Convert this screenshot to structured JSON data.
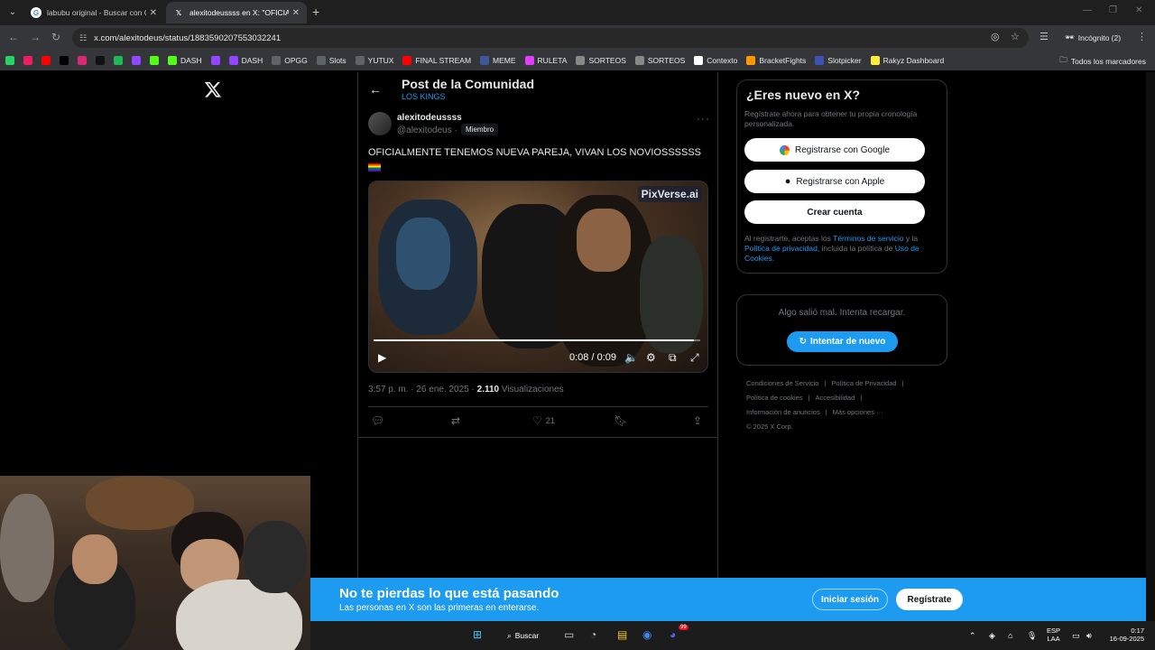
{
  "browser": {
    "tabs": [
      {
        "title": "labubu original - Buscar con Google",
        "icon": "google-icon",
        "active": false
      },
      {
        "title": "alexitodeussss en X: \"OFICIALMENTE",
        "icon": "x-icon",
        "active": true
      }
    ],
    "url": "x.com/alexitodeus/status/1883590207553032241",
    "incognito_label": "Incógnito (2)",
    "bookmarks": [
      {
        "label": "",
        "icon": "whatsapp-icon",
        "color": "#25d366"
      },
      {
        "label": "",
        "icon": "app-icon",
        "color": "#e91e63"
      },
      {
        "label": "",
        "icon": "youtube-icon",
        "color": "#ff0000"
      },
      {
        "label": "",
        "icon": "x-icon",
        "color": "#000000"
      },
      {
        "label": "",
        "icon": "instagram-icon",
        "color": "#d62976"
      },
      {
        "label": "",
        "icon": "tiktok-icon",
        "color": "#111111"
      },
      {
        "label": "",
        "icon": "spotify-icon",
        "color": "#1db954"
      },
      {
        "label": "",
        "icon": "twitch-icon",
        "color": "#9146ff"
      },
      {
        "label": "",
        "icon": "kick-icon",
        "color": "#53fc18"
      },
      {
        "label": "DASH",
        "icon": "kick-icon",
        "color": "#53fc18"
      },
      {
        "label": "",
        "icon": "twitch-icon",
        "color": "#9146ff"
      },
      {
        "label": "DASH",
        "icon": "twitch-icon",
        "color": "#9146ff"
      },
      {
        "label": "OPGG",
        "icon": "folder-icon",
        "color": "#5f6368"
      },
      {
        "label": "Slots",
        "icon": "folder-icon",
        "color": "#5f6368"
      },
      {
        "label": "YUTUX",
        "icon": "folder-icon",
        "color": "#5f6368"
      },
      {
        "label": "FINAL STREAM",
        "icon": "youtube-icon",
        "color": "#ff0000"
      },
      {
        "label": "MEME",
        "icon": "meme-icon",
        "color": "#3b5998"
      },
      {
        "label": "RULETA",
        "icon": "wheel-icon",
        "color": "#e040fb"
      },
      {
        "label": "SORTEOS",
        "icon": "gear-icon",
        "color": "#888888"
      },
      {
        "label": "SORTEOS",
        "icon": "diamond-icon",
        "color": "#888888"
      },
      {
        "label": "Contexto",
        "icon": "c-icon",
        "color": "#ffffff"
      },
      {
        "label": "BracketFights",
        "icon": "bracket-icon",
        "color": "#ff9800"
      },
      {
        "label": "Slotpicker",
        "icon": "sp-icon",
        "color": "#3f51b5"
      },
      {
        "label": "Rakyz Dashboard",
        "icon": "rakyz-icon",
        "color": "#ffeb3b"
      }
    ],
    "all_bookmarks_label": "Todos los marcadores"
  },
  "header": {
    "title": "Post de la Comunidad",
    "community": "LOS KINGS"
  },
  "post": {
    "author_name": "alexitodeussss",
    "author_handle": "@alexitodeus",
    "handle_separator": "·",
    "badge": "Miembro",
    "text": "OFICIALMENTE TENEMOS NUEVA PAREJA, VIVAN LOS NOVIOSSSSSS",
    "video": {
      "watermark": "PixVerse.ai",
      "time": "0:08 / 0:09",
      "progress": 0.98
    },
    "timestamp": "3:57 p. m. · 26 ene. 2025 ·",
    "views_count": "2.110",
    "views_label": "Visualizaciones",
    "likes": "21"
  },
  "signup": {
    "title": "¿Eres nuevo en X?",
    "description": "Regístrate ahora para obtener tu propia cronología personalizada.",
    "google_label": "Registrarse con Google",
    "apple_label": "Registrarse con Apple",
    "create_label": "Crear cuenta",
    "legal_prefix": "Al registrarte, aceptas los ",
    "terms": "Términos de servicio",
    "legal_and": " y la ",
    "privacy": "Política de privacidad",
    "legal_including": ", incluida la política de ",
    "cookies": "Uso de Cookies",
    "legal_end": "."
  },
  "error": {
    "text": "Algo salió mal. Intenta recargar.",
    "retry_label": "Intentar de nuevo"
  },
  "footer": {
    "links": [
      "Condiciones de Servicio",
      "|",
      "Política de Privacidad",
      "|",
      "Política de cookies",
      "|",
      "Accesibilidad",
      "|",
      "Información de anuncios",
      "|",
      "Más opciones ···",
      "© 2025 X Corp."
    ]
  },
  "banner": {
    "title": "No te pierdas lo que está pasando",
    "subtitle": "Las personas en X son las primeras en enterarse.",
    "login_label": "Iniciar sesión",
    "signup_label": "Regístrate"
  },
  "taskbar": {
    "search_label": "Buscar",
    "lang_top": "ESP",
    "lang_bottom": "LAA",
    "time": "0:17",
    "date": "16-09-2025",
    "discord_badge": "99"
  },
  "colors": {
    "accent": "#1d9bf0",
    "background": "#000000",
    "border": "#2f3336",
    "muted": "#71767b"
  }
}
